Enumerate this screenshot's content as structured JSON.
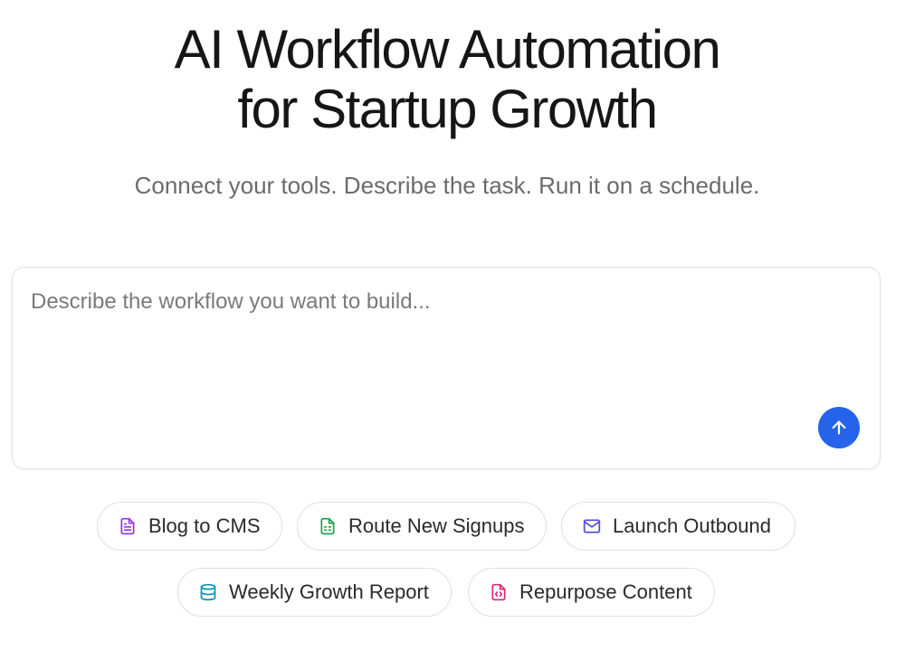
{
  "hero": {
    "title_line1": "AI Workflow Automation",
    "title_line2": "for Startup Growth",
    "subtitle": "Connect your tools. Describe the task. Run it on a schedule."
  },
  "prompt": {
    "placeholder": "Describe the workflow you want to build...",
    "value": "",
    "send_icon": "arrow-up-icon",
    "send_color": "#2563eb"
  },
  "chips": [
    {
      "label": "Blog to CMS",
      "icon": "document-icon",
      "color": "#9333ea"
    },
    {
      "label": "Route New Signups",
      "icon": "spreadsheet-icon",
      "color": "#16a34a"
    },
    {
      "label": "Launch Outbound",
      "icon": "mail-icon",
      "color": "#4f46e5"
    },
    {
      "label": "Weekly Growth Report",
      "icon": "database-icon",
      "color": "#0891b2"
    },
    {
      "label": "Repurpose Content",
      "icon": "code-file-icon",
      "color": "#db2777"
    }
  ]
}
